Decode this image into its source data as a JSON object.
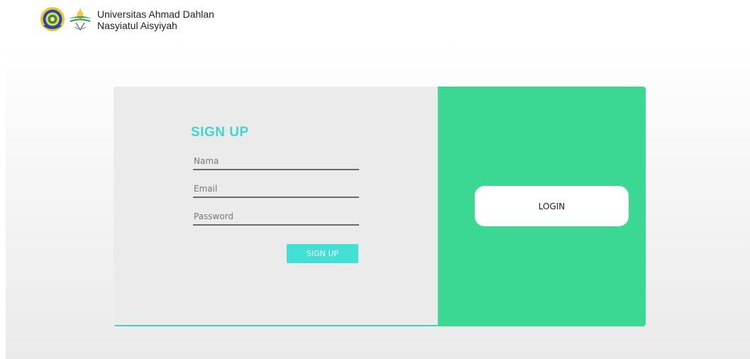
{
  "header": {
    "brand_line1": "Universitas Ahmad Dahlan",
    "brand_line2": "Nasyiatul Aisyiyah",
    "logo1_icon": "university-seal-icon",
    "logo2_icon": "nasyiatul-aisyiyah-emblem-icon"
  },
  "signup": {
    "title": "SIGN UP",
    "name_placeholder": "Nama",
    "email_placeholder": "Email",
    "password_placeholder": "Password",
    "button_label": "SIGN UP"
  },
  "login_panel": {
    "button_label": "LOGIN"
  },
  "colors": {
    "accent_teal": "#41d6d0",
    "panel_green": "#3bd894",
    "form_bg": "#ecebec"
  }
}
